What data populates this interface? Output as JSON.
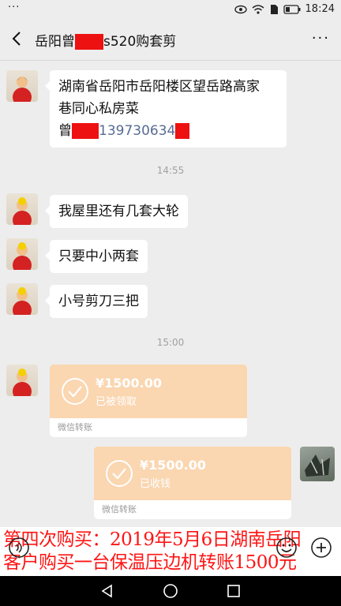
{
  "status_bar": {
    "menu_dots": "···",
    "time": "18:24"
  },
  "header": {
    "title_prefix": "岳阳曾",
    "title_suffix": "s520购套剪"
  },
  "messages": {
    "address_line1": "湖南省岳阳市岳阳楼区望岳路高家",
    "address_line2": "巷同心私房菜",
    "contact_name": "曾",
    "contact_phone": "139730634",
    "time1": "14:55",
    "m1": "我屋里还有几套大轮",
    "m2": "只要中小两套",
    "m3": "小号剪刀三把",
    "time2": "15:00",
    "transfer_received": {
      "amount": "¥1500.00",
      "status": "已被领取",
      "label": "微信转账"
    },
    "transfer_sent": {
      "amount": "¥1500.00",
      "status": "已收钱",
      "label": "微信转账"
    }
  },
  "overlay": {
    "line1": "第四次购买：2019年5月6日湖南岳阳",
    "line2": "客户购买一台保温压边机转账1500元"
  },
  "colors": {
    "redaction": "#ee1111",
    "transfer": "#fad6b1",
    "overlay_text": "#ff1414"
  },
  "icons": [
    "back-arrow-icon",
    "more-icon",
    "voice-icon",
    "emoji-icon",
    "plus-icon",
    "nav-back-icon",
    "nav-home-icon",
    "nav-recent-icon"
  ]
}
